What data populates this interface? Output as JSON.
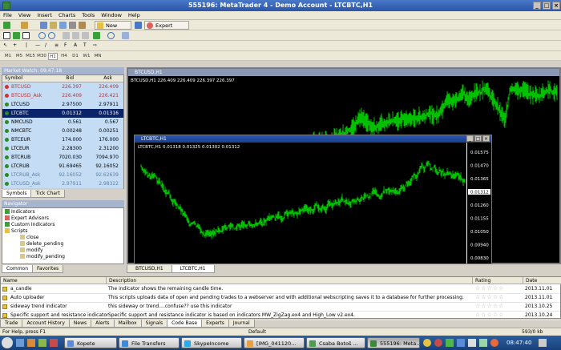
{
  "window": {
    "title": "555196: MetaTrader 4 - Demo Account - LTCBTC,H1"
  },
  "menu": [
    "File",
    "View",
    "Insert",
    "Charts",
    "Tools",
    "Window",
    "Help"
  ],
  "toolbar": {
    "new_order": "New Order",
    "expert_advisors": "Expert Advisors"
  },
  "timeframes": [
    "M1",
    "M5",
    "M15",
    "M30",
    "H1",
    "H4",
    "D1",
    "W1",
    "MN"
  ],
  "active_timeframe": "H1",
  "market_watch": {
    "title": "Market Watch: 09:47:18",
    "columns": [
      "Symbol",
      "Bid",
      "Ask"
    ],
    "rows": [
      {
        "symbol": "BTCUSD",
        "bid": "226.397",
        "ask": "226.409",
        "color": "#cc3333",
        "style": "red"
      },
      {
        "symbol": "BTCUSD_Ask",
        "bid": "226.409",
        "ask": "226.421",
        "color": "#cc3333",
        "style": "red"
      },
      {
        "symbol": "LTCUSD",
        "bid": "2.97500",
        "ask": "2.97911",
        "color": "#2a8a2a",
        "style": "normal"
      },
      {
        "symbol": "LTCBTC",
        "bid": "0.01312",
        "ask": "0.01316",
        "color": "#2a8a2a",
        "style": "selected"
      },
      {
        "symbol": "NMCUSD",
        "bid": "0.561",
        "ask": "0.567",
        "color": "#2a8a2a",
        "style": "normal"
      },
      {
        "symbol": "NMCBTC",
        "bid": "0.00248",
        "ask": "0.00251",
        "color": "#2a8a2a",
        "style": "normal"
      },
      {
        "symbol": "BTCEUR",
        "bid": "174.000",
        "ask": "176.000",
        "color": "#2a8a2a",
        "style": "normal"
      },
      {
        "symbol": "LTCEUR",
        "bid": "2.28300",
        "ask": "2.31200",
        "color": "#2a8a2a",
        "style": "normal"
      },
      {
        "symbol": "BTCRUB",
        "bid": "7020.030",
        "ask": "7094.970",
        "color": "#2a8a2a",
        "style": "normal"
      },
      {
        "symbol": "LTCRUB",
        "bid": "91.69465",
        "ask": "92.16052",
        "color": "#2a8a2a",
        "style": "normal"
      },
      {
        "symbol": "LTCRUB_Ask",
        "bid": "92.16052",
        "ask": "92.62639",
        "color": "#2a8a2a",
        "style": "normal"
      },
      {
        "symbol": "LTCUSD_Ask",
        "bid": "2.97911",
        "ask": "2.98322",
        "color": "#2a8a2a",
        "style": "normal"
      }
    ],
    "tabs": [
      "Symbols",
      "Tick Chart"
    ]
  },
  "navigator": {
    "title": "Navigator",
    "items": [
      "Indicators",
      "Expert Advisors",
      "Custom Indicators",
      "Scripts",
      "close",
      "delete_pending",
      "modify",
      "modify_pending"
    ],
    "tabs": [
      "Common",
      "Favorites"
    ]
  },
  "chart_btcusd": {
    "title": "BTCUSD,H1",
    "info": "BTCUSD,H1  226.409 226.409 226.397 226.397"
  },
  "chart_ltcbtc": {
    "title": "LTCBTC,H1",
    "info": "LTCBTC,H1  0.01318 0.01325 0.01302 0.01312",
    "price_labels": [
      "0.01575",
      "0.01470",
      "0.01365",
      "0.01312",
      "0.01260",
      "0.01155",
      "0.01050",
      "0.00940",
      "0.00830"
    ],
    "current_price": "0.01312"
  },
  "chart_tabs": [
    "BTCUSD,H1",
    "LTCBTC,H1"
  ],
  "terminal": {
    "columns": [
      "Name",
      "Description",
      "Rating",
      "Date"
    ],
    "rows": [
      {
        "name": "a_candle",
        "desc": "The indicator shows the remaining candle time.",
        "rating": "☆☆☆☆☆",
        "date": "2013.11.01"
      },
      {
        "name": "Auto uploader",
        "desc": "This scripts uploads data of open and pending trades to a webserver and with additional webscripting saves it to a database for further processing.",
        "rating": "☆☆☆☆☆",
        "date": "2013.11.01"
      },
      {
        "name": "sideway trend indicator",
        "desc": "this sideway or trend....confuse?? use this indicator",
        "rating": "☆☆☆☆☆",
        "date": "2013.10.25"
      },
      {
        "name": "Specific support and resistance indicator",
        "desc": "Specific support and resistance indicator is based on indicators MW_ZigZag.ex4 and High_Low v2.ex4.",
        "rating": "☆☆☆☆☆",
        "date": "2013.10.24"
      }
    ],
    "tabs": [
      "Trade",
      "Account History",
      "News",
      "Alerts",
      "Mailbox",
      "Signals",
      "Code Base",
      "Experts",
      "Journal"
    ],
    "active_tab": "Code Base"
  },
  "status": {
    "help": "For Help, press F1",
    "profile": "Default",
    "traffic": "593/0 kb"
  },
  "taskbar": {
    "items": [
      "Kopete",
      "File Transfers",
      "SkypeIncome",
      "[IMG_041120...",
      "Csaba Botoš ...",
      "555196: Meta..."
    ],
    "clock": "08:47:40"
  },
  "colors": {
    "candle": "#00c000",
    "chart_bg": "#000000",
    "accent": "#0a246a"
  }
}
